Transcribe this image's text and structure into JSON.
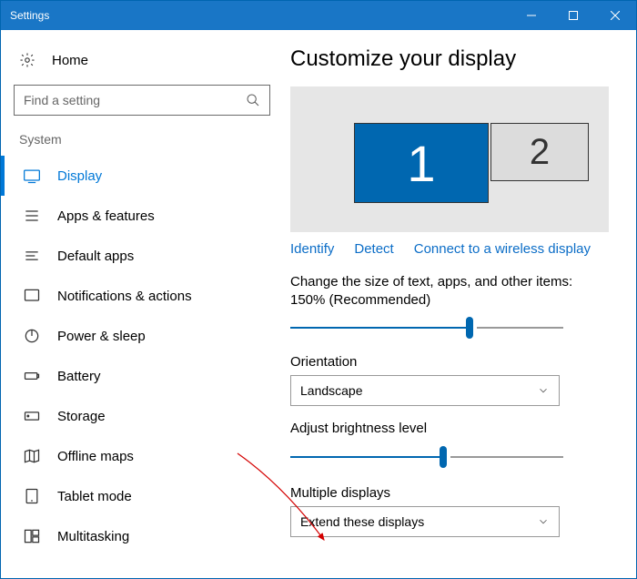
{
  "window": {
    "title": "Settings"
  },
  "sidebar": {
    "home_label": "Home",
    "search_placeholder": "Find a setting",
    "section_label": "System",
    "items": [
      {
        "label": "Display"
      },
      {
        "label": "Apps & features"
      },
      {
        "label": "Default apps"
      },
      {
        "label": "Notifications & actions"
      },
      {
        "label": "Power & sleep"
      },
      {
        "label": "Battery"
      },
      {
        "label": "Storage"
      },
      {
        "label": "Offline maps"
      },
      {
        "label": "Tablet mode"
      },
      {
        "label": "Multitasking"
      }
    ]
  },
  "main": {
    "title": "Customize your display",
    "monitors": {
      "m1": "1",
      "m2": "2"
    },
    "actions": {
      "identify": "Identify",
      "detect": "Detect",
      "connect": "Connect to a wireless display"
    },
    "scale_text": "Change the size of text, apps, and other items: 150% (Recommended)",
    "orientation_label": "Orientation",
    "orientation_value": "Landscape",
    "brightness_label": "Adjust brightness level",
    "multiple_label": "Multiple displays",
    "multiple_value": "Extend these displays"
  }
}
